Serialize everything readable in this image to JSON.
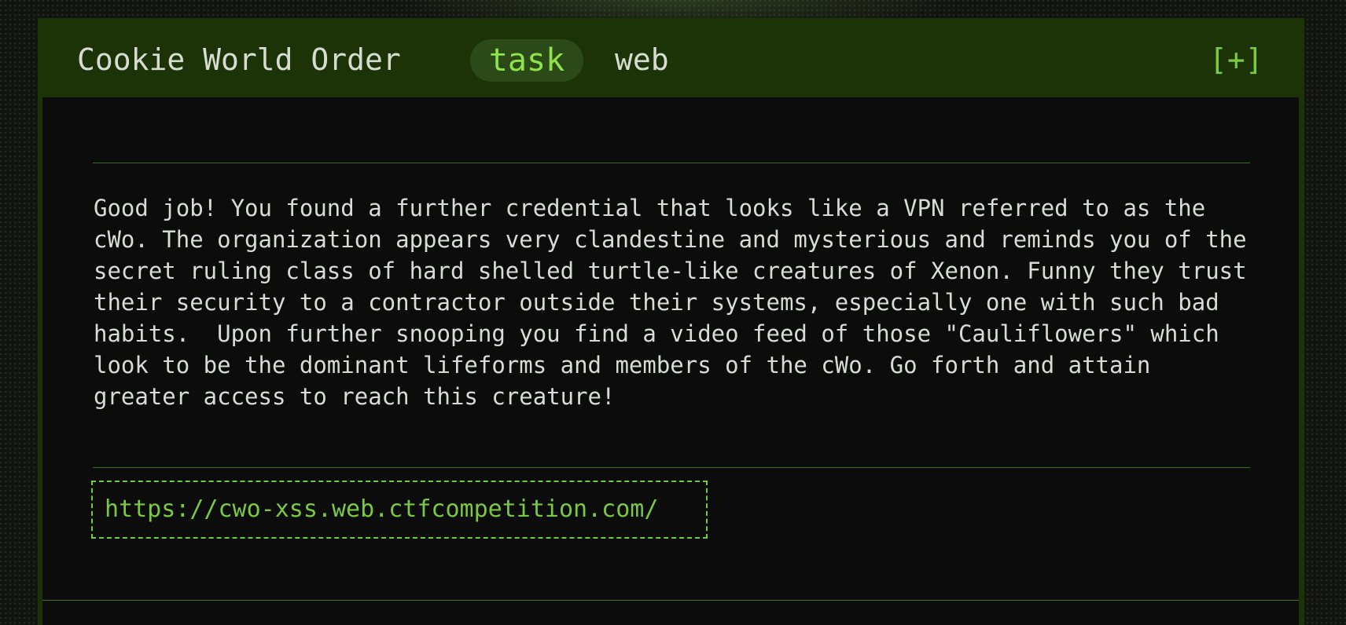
{
  "challenge": {
    "title": "Cookie World Order",
    "badge": "task",
    "category": "web",
    "expand_label": "[+]",
    "description": "Good job! You found a further credential that looks like a VPN referred to as the cWo. The organization appears very clandestine and mysterious and reminds you of the secret ruling class of hard shelled turtle-like creatures of Xenon. Funny they trust their security to a contractor outside their systems, especially one with such bad habits.  Upon further snooping you find a video feed of those \"Cauliflowers\" which look to be the dominant lifeforms and members of the cWo. Go forth and attain greater access to reach this creature!",
    "url": "https://cwo-xss.web.ctfcompetition.com/"
  },
  "colors": {
    "header_bg": "#1b3307",
    "body_bg": "#0b0c0b",
    "accent": "#7ac943",
    "badge_text": "#8fe34a",
    "badge_bg": "#2c4a18",
    "text": "#d9dcd6"
  }
}
